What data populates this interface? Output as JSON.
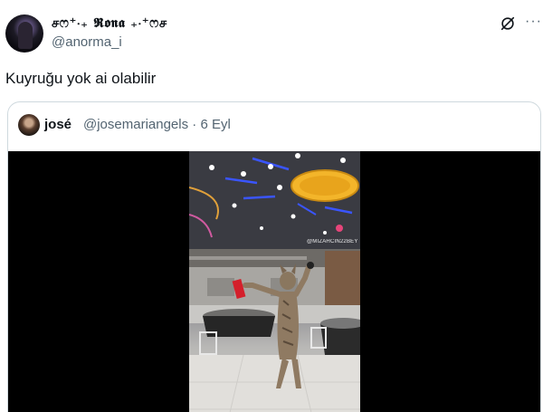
{
  "author": {
    "display_name": "சෆ⁺‧₊ 𝕽𝖔𝖓𝖆 ₊‧⁺ෆச",
    "handle": "@anorma_i"
  },
  "icons": {
    "grok": "grok-icon",
    "more": "more-icon"
  },
  "tweet": {
    "text": "Kuyruğu yok ai olabilir"
  },
  "quoted": {
    "name": "josé",
    "handle": "@josemariangels",
    "separator": "·",
    "date": "6 Eyl",
    "media": {
      "watermark": "@MIZAHCIN22BEY"
    }
  }
}
